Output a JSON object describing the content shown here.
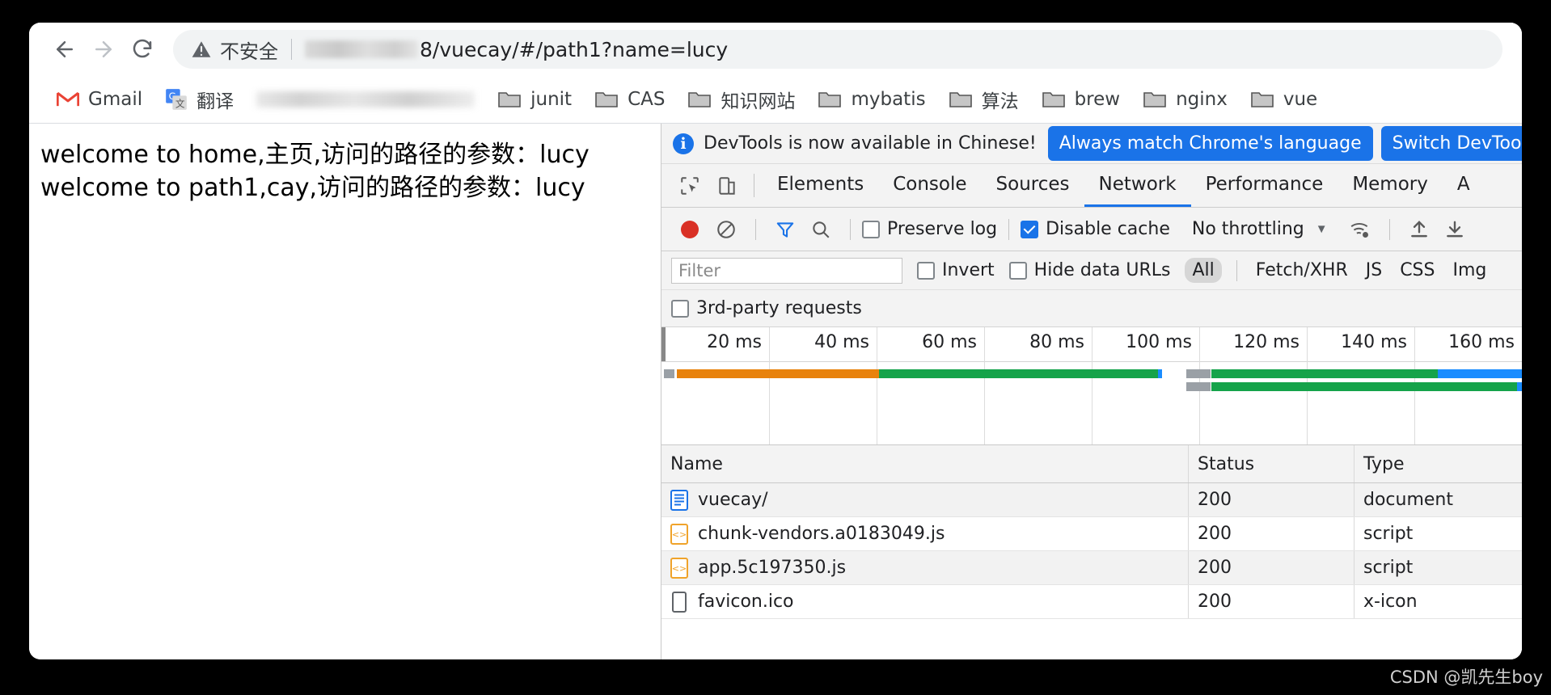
{
  "browser": {
    "nav": {
      "back_icon": "arrow-left-icon",
      "forward_icon": "arrow-right-icon",
      "reload_icon": "reload-icon"
    },
    "omnibox": {
      "security_icon": "warning-triangle-icon",
      "security_label": "不安全",
      "url_redacted": true,
      "url_text": "8/vuecay/#/path1?name=lucy"
    },
    "bookmarks": [
      {
        "label": "Gmail",
        "icon": "gmail-icon"
      },
      {
        "label": "翻译",
        "icon": "google-translate-icon"
      },
      {
        "label": "",
        "icon": "redacted-bookmark"
      },
      {
        "label": "junit",
        "icon": "folder-icon"
      },
      {
        "label": "CAS",
        "icon": "folder-icon"
      },
      {
        "label": "知识网站",
        "icon": "folder-icon"
      },
      {
        "label": "mybatis",
        "icon": "folder-icon"
      },
      {
        "label": "算法",
        "icon": "folder-icon"
      },
      {
        "label": "brew",
        "icon": "folder-icon"
      },
      {
        "label": "nginx",
        "icon": "folder-icon"
      },
      {
        "label": "vue",
        "icon": "folder-icon"
      }
    ]
  },
  "page": {
    "lines": [
      "welcome to home,主页,访问的路径的参数：lucy",
      "welcome to path1,cay,访问的路径的参数：lucy"
    ]
  },
  "devtools": {
    "banner": {
      "info_icon": "info-icon",
      "message": "DevTools is now available in Chinese!",
      "primary_button": "Always match Chrome's language",
      "secondary_button": "Switch DevTools"
    },
    "tabs": [
      {
        "label": "Elements",
        "active": false
      },
      {
        "label": "Console",
        "active": false
      },
      {
        "label": "Sources",
        "active": false
      },
      {
        "label": "Network",
        "active": true
      },
      {
        "label": "Performance",
        "active": false
      },
      {
        "label": "Memory",
        "active": false
      },
      {
        "label": "A",
        "active": false
      }
    ],
    "tab_icons": [
      {
        "name": "inspect-element-icon"
      },
      {
        "name": "device-toolbar-icon"
      }
    ],
    "toolbar": {
      "record_icon": "record-button-icon",
      "clear_icon": "clear-icon",
      "filter_icon": "filter-funnel-icon",
      "search_icon": "search-icon",
      "preserve_log_label": "Preserve log",
      "preserve_log_checked": false,
      "disable_cache_label": "Disable cache",
      "disable_cache_checked": true,
      "throttling_value": "No throttling",
      "throttling_caret": "chevron-down-icon",
      "network_conditions_icon": "wifi-gear-icon",
      "import_har_icon": "upload-arrow-icon",
      "export_har_icon": "download-arrow-icon"
    },
    "filterbar": {
      "filter_placeholder": "Filter",
      "filter_value": "",
      "invert_label": "Invert",
      "invert_checked": false,
      "hide_data_urls_label": "Hide data URLs",
      "hide_data_urls_checked": false,
      "types": [
        {
          "label": "All",
          "selected": true
        },
        {
          "label": "Fetch/XHR",
          "selected": false
        },
        {
          "label": "JS",
          "selected": false
        },
        {
          "label": "CSS",
          "selected": false
        },
        {
          "label": "Img",
          "selected": false
        }
      ]
    },
    "thirdparty": {
      "label": "3rd-party requests",
      "checked": false
    },
    "overview": {
      "ticks": [
        "20 ms",
        "40 ms",
        "60 ms",
        "80 ms",
        "100 ms",
        "120 ms",
        "140 ms",
        "160 ms"
      ],
      "bars": [
        {
          "left_pct": 0.3,
          "width_pct": 1.2,
          "color": "#9aa0a6",
          "row": 0,
          "kind": "block"
        },
        {
          "left_pct": 1.8,
          "width_pct": 23.5,
          "color": "#e8820c",
          "row": 0,
          "kind": "bar"
        },
        {
          "left_pct": 25.3,
          "width_pct": 32.4,
          "color": "#15a34a",
          "row": 0,
          "kind": "bar"
        },
        {
          "left_pct": 57.7,
          "width_pct": 0.5,
          "color": "#1a8cff",
          "row": 0,
          "kind": "bar"
        },
        {
          "left_pct": 61.0,
          "width_pct": 2.8,
          "color": "#9aa0a6",
          "row": 0,
          "kind": "bar"
        },
        {
          "left_pct": 63.9,
          "width_pct": 26.3,
          "color": "#15a34a",
          "row": 0,
          "kind": "bar"
        },
        {
          "left_pct": 90.2,
          "width_pct": 9.8,
          "color": "#1a8cff",
          "row": 0,
          "kind": "bar"
        },
        {
          "left_pct": 61.0,
          "width_pct": 2.8,
          "color": "#9aa0a6",
          "row": 1,
          "kind": "bar"
        },
        {
          "left_pct": 63.9,
          "width_pct": 35.5,
          "color": "#15a34a",
          "row": 1,
          "kind": "bar"
        },
        {
          "left_pct": 99.4,
          "width_pct": 0.6,
          "color": "#1a8cff",
          "row": 1,
          "kind": "bar"
        }
      ]
    },
    "table": {
      "columns": [
        "Name",
        "Status",
        "Type"
      ],
      "rows": [
        {
          "name": "vuecay/",
          "status": "200",
          "type": "document",
          "icon": "document-icon"
        },
        {
          "name": "chunk-vendors.a0183049.js",
          "status": "200",
          "type": "script",
          "icon": "script-icon"
        },
        {
          "name": "app.5c197350.js",
          "status": "200",
          "type": "script",
          "icon": "script-icon"
        },
        {
          "name": "favicon.ico",
          "status": "200",
          "type": "x-icon",
          "icon": "generic-file-icon"
        }
      ]
    }
  },
  "watermark": "CSDN @凯先生boy"
}
